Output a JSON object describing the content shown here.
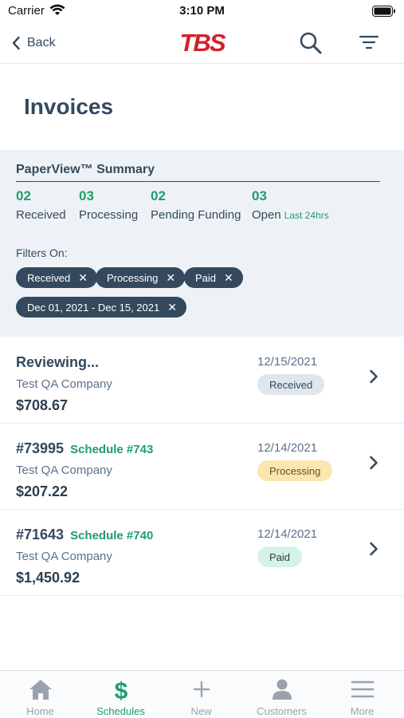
{
  "status_bar": {
    "carrier": "Carrier",
    "time": "3:10 PM"
  },
  "nav": {
    "back_label": "Back",
    "logo_text": "TBS"
  },
  "page": {
    "title": "Invoices"
  },
  "summary": {
    "title": "PaperView™ Summary",
    "stats": [
      {
        "count": "02",
        "label": "Received"
      },
      {
        "count": "03",
        "label": "Processing"
      },
      {
        "count": "02",
        "label": "Pending Funding"
      },
      {
        "count": "03",
        "label": "Open",
        "sub": "Last 24hrs"
      }
    ],
    "filters_label": "Filters On:",
    "filters": [
      "Received",
      "Processing",
      "Paid",
      "Dec 01, 2021 - Dec 15, 2021"
    ]
  },
  "invoices": [
    {
      "id": "Reviewing...",
      "schedule": "",
      "company": "Test QA Company",
      "amount": "$708.67",
      "date": "12/15/2021",
      "status": "Received"
    },
    {
      "id": "#73995",
      "schedule": "Schedule #743",
      "company": "Test QA Company",
      "amount": "$207.22",
      "date": "12/14/2021",
      "status": "Processing"
    },
    {
      "id": "#71643",
      "schedule": "Schedule #740",
      "company": "Test QA Company",
      "amount": "$1,450.92",
      "date": "12/14/2021",
      "status": "Paid"
    }
  ],
  "tabs": [
    {
      "label": "Home",
      "icon": "home-icon"
    },
    {
      "label": "Schedules",
      "icon": "dollar-icon",
      "active": true
    },
    {
      "label": "New",
      "icon": "plus-icon"
    },
    {
      "label": "Customers",
      "icon": "person-icon"
    },
    {
      "label": "More",
      "icon": "menu-icon"
    }
  ],
  "colors": {
    "accent_green": "#1f9d6b",
    "brand_red": "#d32027",
    "navy": "#34495e"
  }
}
